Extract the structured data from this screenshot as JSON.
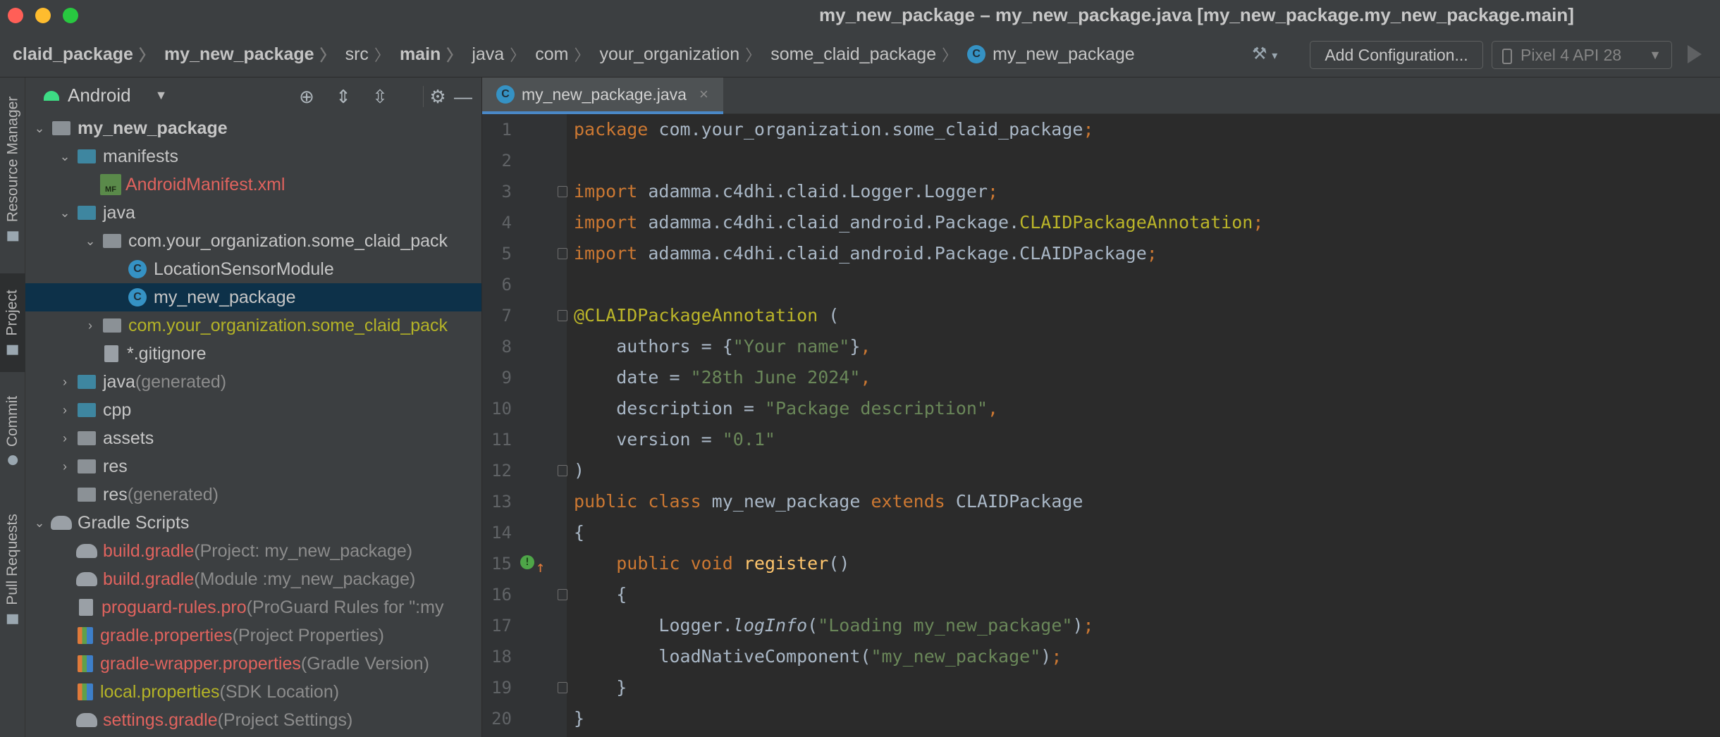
{
  "window": {
    "title": "my_new_package – my_new_package.java [my_new_package.my_new_package.main]",
    "controls": [
      "close",
      "minimize",
      "maximize"
    ]
  },
  "breadcrumbs": [
    {
      "label": "claid_package",
      "bold": true
    },
    {
      "label": "my_new_package",
      "bold": true
    },
    {
      "label": "src",
      "bold": false
    },
    {
      "label": "main",
      "bold": true
    },
    {
      "label": "java",
      "bold": false
    },
    {
      "label": "com",
      "bold": false
    },
    {
      "label": "your_organization",
      "bold": false
    },
    {
      "label": "some_claid_package",
      "bold": false
    },
    {
      "label": "my_new_package",
      "bold": false,
      "icon": "C"
    }
  ],
  "toolbar": {
    "build_icon": "hammer-icon",
    "config_label": "Add Configuration...",
    "device_label": "Pixel 4 API 28",
    "run_icon": "run-icon"
  },
  "tool_windows": {
    "resource_manager": "Resource Manager",
    "project": "Project",
    "commit": "Commit",
    "pull_requests": "Pull Requests"
  },
  "project_panel": {
    "view_label": "Android",
    "icon_glyphs": {
      "class": "C",
      "manifest": "MF"
    },
    "tree": [
      {
        "label": "my_new_package",
        "extra": "",
        "style": "bold",
        "icon": "module"
      },
      {
        "label": "manifests",
        "extra": "",
        "style": "normal",
        "icon": "folder"
      },
      {
        "label": "AndroidManifest.xml",
        "extra": "",
        "style": "red",
        "icon": "manifest"
      },
      {
        "label": "java",
        "extra": "",
        "style": "normal",
        "icon": "folder"
      },
      {
        "label": "com.your_organization.some_claid_pack",
        "extra": "",
        "style": "normal",
        "icon": "package"
      },
      {
        "label": "LocationSensorModule",
        "extra": "",
        "style": "normal",
        "icon": "class"
      },
      {
        "label": "my_new_package",
        "extra": "",
        "style": "normal",
        "icon": "class",
        "selected": true
      },
      {
        "label": "com.your_organization.some_claid_pack",
        "extra": "",
        "style": "olive",
        "icon": "package"
      },
      {
        "label": "*.gitignore",
        "extra": "",
        "style": "normal",
        "icon": "file"
      },
      {
        "label": "java",
        "extra": " (generated)",
        "style": "normal",
        "icon": "folder"
      },
      {
        "label": "cpp",
        "extra": "",
        "style": "normal",
        "icon": "folder"
      },
      {
        "label": "assets",
        "extra": "",
        "style": "normal",
        "icon": "folder-gray"
      },
      {
        "label": "res",
        "extra": "",
        "style": "normal",
        "icon": "folder-gray"
      },
      {
        "label": "res",
        "extra": " (generated)",
        "style": "normal",
        "icon": "folder-gray"
      },
      {
        "label": "Gradle Scripts",
        "extra": "",
        "style": "normal",
        "icon": "gradle"
      },
      {
        "label": "build.gradle",
        "extra": " (Project: my_new_package)",
        "style": "red",
        "icon": "gradle"
      },
      {
        "label": "build.gradle",
        "extra": " (Module :my_new_package)",
        "style": "red",
        "icon": "gradle"
      },
      {
        "label": "proguard-rules.pro",
        "extra": " (ProGuard Rules for \":my",
        "style": "red",
        "icon": "file"
      },
      {
        "label": "gradle.properties",
        "extra": " (Project Properties)",
        "style": "red",
        "icon": "props"
      },
      {
        "label": "gradle-wrapper.properties",
        "extra": " (Gradle Version)",
        "style": "red",
        "icon": "props"
      },
      {
        "label": "local.properties",
        "extra": " (SDK Location)",
        "style": "olive",
        "icon": "props"
      },
      {
        "label": "settings.gradle",
        "extra": " (Project Settings)",
        "style": "red",
        "icon": "gradle"
      }
    ]
  },
  "editor": {
    "tab": {
      "label": "my_new_package.java",
      "icon": "C",
      "close": "×"
    },
    "lines": [
      {
        "n": "1",
        "tokens": [
          [
            "kw",
            "package"
          ],
          [
            "plain",
            " com.your_organization.some_claid_package"
          ],
          [
            "kw",
            ";"
          ]
        ]
      },
      {
        "n": "2",
        "tokens": []
      },
      {
        "n": "3",
        "fold": true,
        "tokens": [
          [
            "kw",
            "import"
          ],
          [
            "plain",
            " adamma.c4dhi.claid.Logger.Logger"
          ],
          [
            "kw",
            ";"
          ]
        ]
      },
      {
        "n": "4",
        "tokens": [
          [
            "kw",
            "import"
          ],
          [
            "plain",
            " adamma.c4dhi.claid_android.Package."
          ],
          [
            "ann",
            "CLAIDPackageAnnotation"
          ],
          [
            "kw",
            ";"
          ]
        ]
      },
      {
        "n": "5",
        "fold": true,
        "tokens": [
          [
            "kw",
            "import"
          ],
          [
            "plain",
            " adamma.c4dhi.claid_android.Package.CLAIDPackage"
          ],
          [
            "kw",
            ";"
          ]
        ]
      },
      {
        "n": "6",
        "tokens": []
      },
      {
        "n": "7",
        "fold": true,
        "tokens": [
          [
            "ann",
            "@CLAIDPackageAnnotation"
          ],
          [
            "plain",
            " ("
          ]
        ]
      },
      {
        "n": "8",
        "tokens": [
          [
            "plain",
            "    authors = {"
          ],
          [
            "str",
            "\"Your name\""
          ],
          [
            "plain",
            "}"
          ],
          [
            "kw",
            ","
          ]
        ]
      },
      {
        "n": "9",
        "tokens": [
          [
            "plain",
            "    date = "
          ],
          [
            "str",
            "\"28th June 2024\""
          ],
          [
            "kw",
            ","
          ]
        ]
      },
      {
        "n": "10",
        "tokens": [
          [
            "plain",
            "    description = "
          ],
          [
            "str",
            "\"Package description\""
          ],
          [
            "kw",
            ","
          ]
        ]
      },
      {
        "n": "11",
        "tokens": [
          [
            "plain",
            "    version = "
          ],
          [
            "str",
            "\"0.1\""
          ]
        ]
      },
      {
        "n": "12",
        "fold": true,
        "tokens": [
          [
            "plain",
            ")"
          ]
        ]
      },
      {
        "n": "13",
        "tokens": [
          [
            "kw",
            "public class"
          ],
          [
            "plain",
            " my_new_package "
          ],
          [
            "kw",
            "extends"
          ],
          [
            "plain",
            " CLAIDPackage"
          ]
        ]
      },
      {
        "n": "14",
        "tokens": [
          [
            "plain",
            "{"
          ]
        ]
      },
      {
        "n": "15",
        "marker": true,
        "tokens": [
          [
            "plain",
            "    "
          ],
          [
            "kw",
            "public void"
          ],
          [
            "plain",
            " "
          ],
          [
            "fn",
            "register"
          ],
          [
            "plain",
            "()"
          ]
        ]
      },
      {
        "n": "16",
        "fold": true,
        "tokens": [
          [
            "plain",
            "    {"
          ]
        ]
      },
      {
        "n": "17",
        "tokens": [
          [
            "plain",
            "        Logger."
          ],
          [
            "it",
            "logInfo"
          ],
          [
            "plain",
            "("
          ],
          [
            "str",
            "\"Loading my_new_package\""
          ],
          [
            "plain",
            ")"
          ],
          [
            "kw",
            ";"
          ]
        ]
      },
      {
        "n": "18",
        "tokens": [
          [
            "plain",
            "        loadNativeComponent("
          ],
          [
            "str",
            "\"my_new_package\""
          ],
          [
            "plain",
            ")"
          ],
          [
            "kw",
            ";"
          ]
        ]
      },
      {
        "n": "19",
        "fold": true,
        "tokens": [
          [
            "plain",
            "    }"
          ]
        ]
      },
      {
        "n": "20",
        "tokens": [
          [
            "plain",
            "}"
          ]
        ]
      }
    ]
  },
  "colors": {
    "keyword": "#cc7832",
    "string": "#6a8759",
    "annotation": "#bbb529",
    "function": "#ffc66d",
    "text": "#a9b7c6",
    "selection": "#0d3149",
    "tab_underline": "#4a88c7"
  }
}
